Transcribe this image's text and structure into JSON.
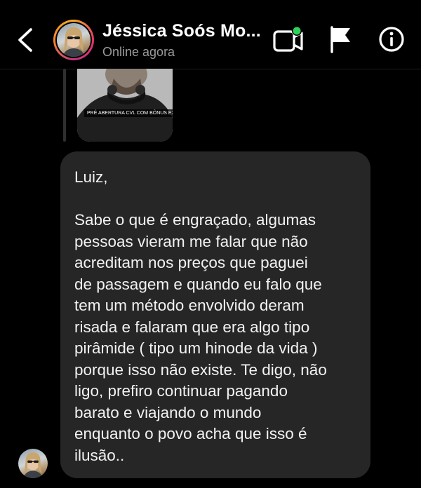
{
  "header": {
    "contact_name": "Jéssica Soós Mo...",
    "status": "Online agora",
    "icons": {
      "back": "chevron-left-icon",
      "video": "video-call-icon",
      "flag": "flag-icon",
      "info": "info-icon"
    },
    "online_dot_color": "#2fd05c"
  },
  "shared_post": {
    "caption": "PRÉ ABERTURA CVL COM BÔNUS EXCLUSIVOS"
  },
  "message": {
    "greeting": "Luiz,",
    "body": "Sabe o que é engraçado, algumas\npessoas vieram me falar que não\nacreditam nos preços que paguei\nde passagem e quando eu falo que\ntem um método envolvido deram\nrisada e falaram que era algo tipo\npirâmide ( tipo um hinode da vida )\nporque isso não existe. Te digo, não\nligo, prefiro continuar pagando\nbarato e viajando o mundo\nenquanto o povo acha que isso é\nilusão.."
  },
  "colors": {
    "background": "#000000",
    "bubble": "#262626",
    "subtitle": "#9a9a9a"
  }
}
